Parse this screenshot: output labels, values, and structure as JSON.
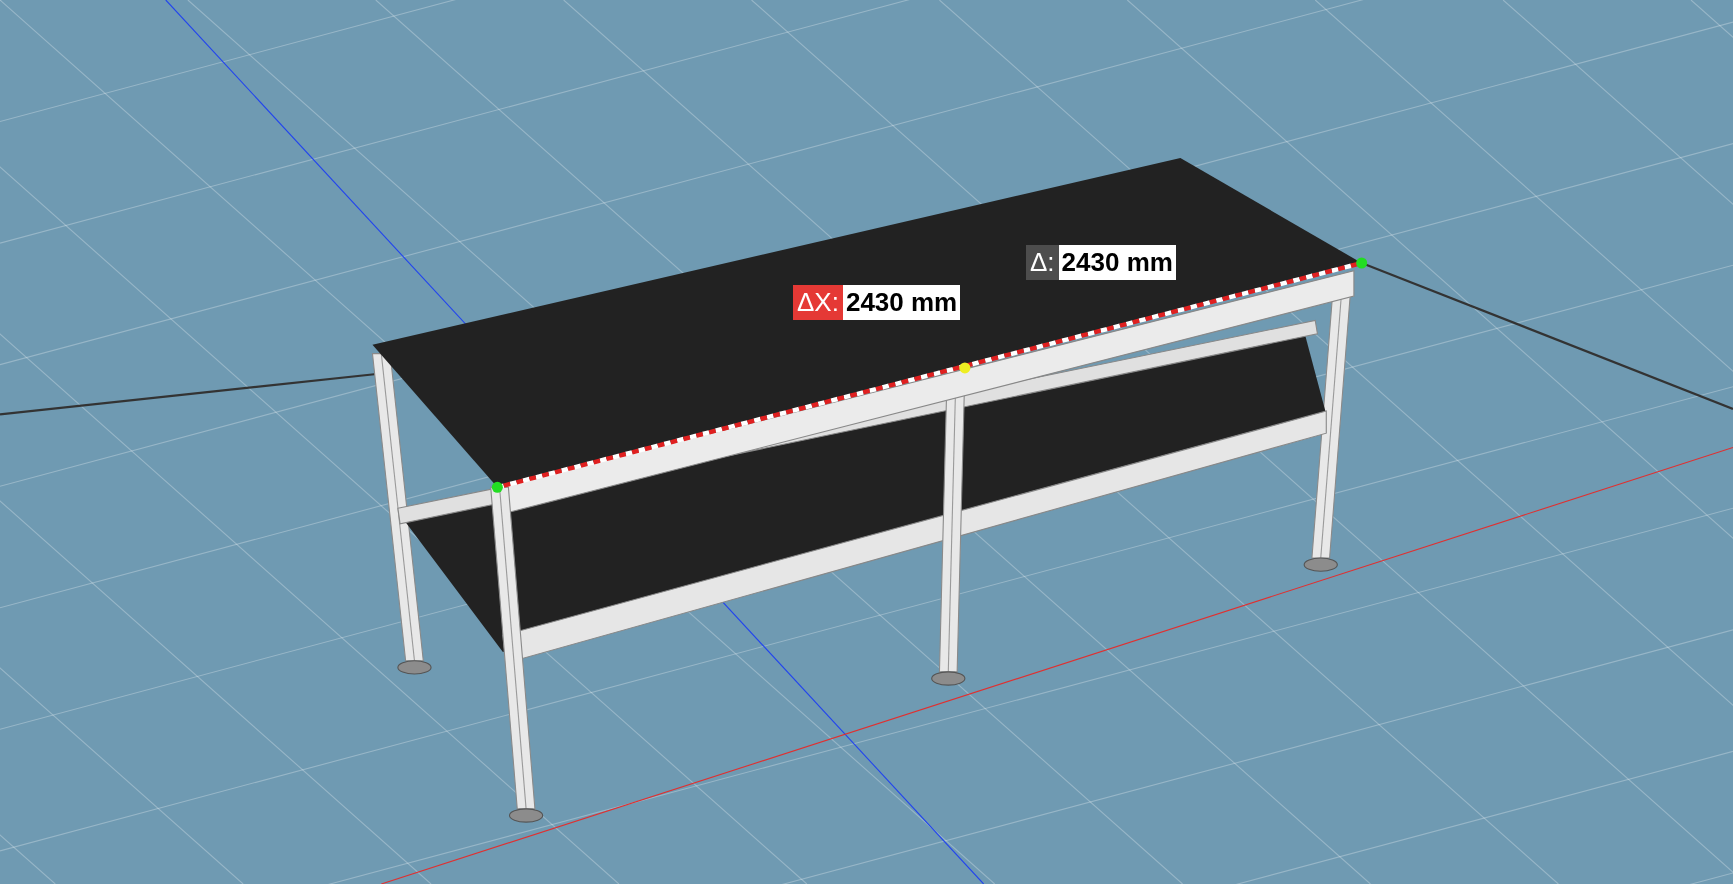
{
  "measurements": [
    {
      "axis_label": "ΔX:",
      "value": "2430 mm",
      "color": "#e53935"
    },
    {
      "axis_label": "Δ:",
      "value": "2430 mm",
      "color": "#4d4d4d"
    }
  ]
}
